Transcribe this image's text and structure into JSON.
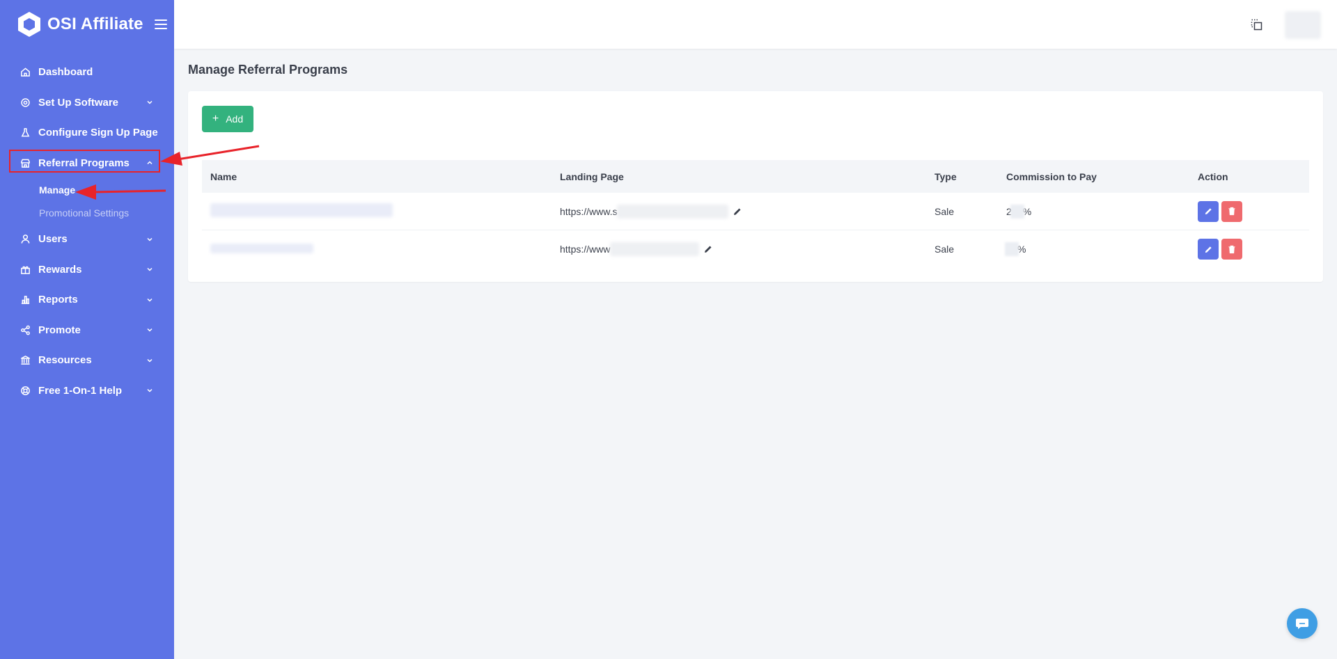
{
  "brand": {
    "name": "OSI Affiliate"
  },
  "sidebar": {
    "items": [
      {
        "label": "Dashboard",
        "icon": "home-icon",
        "has_chevron": false
      },
      {
        "label": "Set Up Software",
        "icon": "gear-icon",
        "has_chevron": true
      },
      {
        "label": "Configure Sign Up Page",
        "icon": "flask-icon",
        "has_chevron": false
      },
      {
        "label": "Referral Programs",
        "icon": "store-icon",
        "has_chevron": true,
        "expanded": true
      },
      {
        "label": "Users",
        "icon": "user-icon",
        "has_chevron": true
      },
      {
        "label": "Rewards",
        "icon": "gift-icon",
        "has_chevron": true
      },
      {
        "label": "Reports",
        "icon": "chart-icon",
        "has_chevron": true
      },
      {
        "label": "Promote",
        "icon": "share-icon",
        "has_chevron": true
      },
      {
        "label": "Resources",
        "icon": "bank-icon",
        "has_chevron": true
      },
      {
        "label": "Free 1-On-1 Help",
        "icon": "lifebuoy-icon",
        "has_chevron": true
      }
    ],
    "submenu": [
      {
        "label": "Manage",
        "current": true
      },
      {
        "label": "Promotional Settings",
        "current": false
      }
    ]
  },
  "page": {
    "title": "Manage Referral Programs"
  },
  "toolbar": {
    "add_label": "Add"
  },
  "table": {
    "headers": [
      "Name",
      "Landing Page",
      "Type",
      "Commission to Pay",
      "Action"
    ],
    "rows": [
      {
        "landing": "https://www.s",
        "type": "Sale",
        "commission_prefix": "2",
        "commission_suffix": "%"
      },
      {
        "landing": "https://www",
        "type": "Sale",
        "commission_prefix": "",
        "commission_suffix": "%"
      }
    ]
  },
  "colors": {
    "sidebar": "#5d73e6",
    "add_button": "#33b27e",
    "edit_button": "#5d73e6",
    "delete_button": "#ef6a6e",
    "annotation": "#e8232a"
  }
}
